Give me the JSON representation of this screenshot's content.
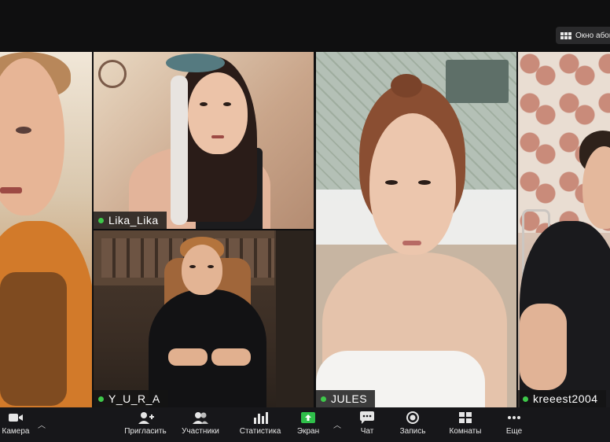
{
  "top_bar": {
    "view_button_label": "Окно абон"
  },
  "participants": [
    {
      "name": ""
    },
    {
      "name": "Lika_Lika"
    },
    {
      "name": "Y_U_R_A"
    },
    {
      "name": "JULES"
    },
    {
      "name": "kreeest2004"
    }
  ],
  "toolbar": {
    "camera": "Камера",
    "invite": "Пригласить",
    "participants": "Участники",
    "stats": "Статистика",
    "share": "Экран",
    "chat": "Чат",
    "record": "Запись",
    "rooms": "Комнаты",
    "more": "Еще"
  },
  "colors": {
    "mic_active": "#3ec84a",
    "share_green": "#2fbf4a",
    "background": "#0f0f10"
  }
}
